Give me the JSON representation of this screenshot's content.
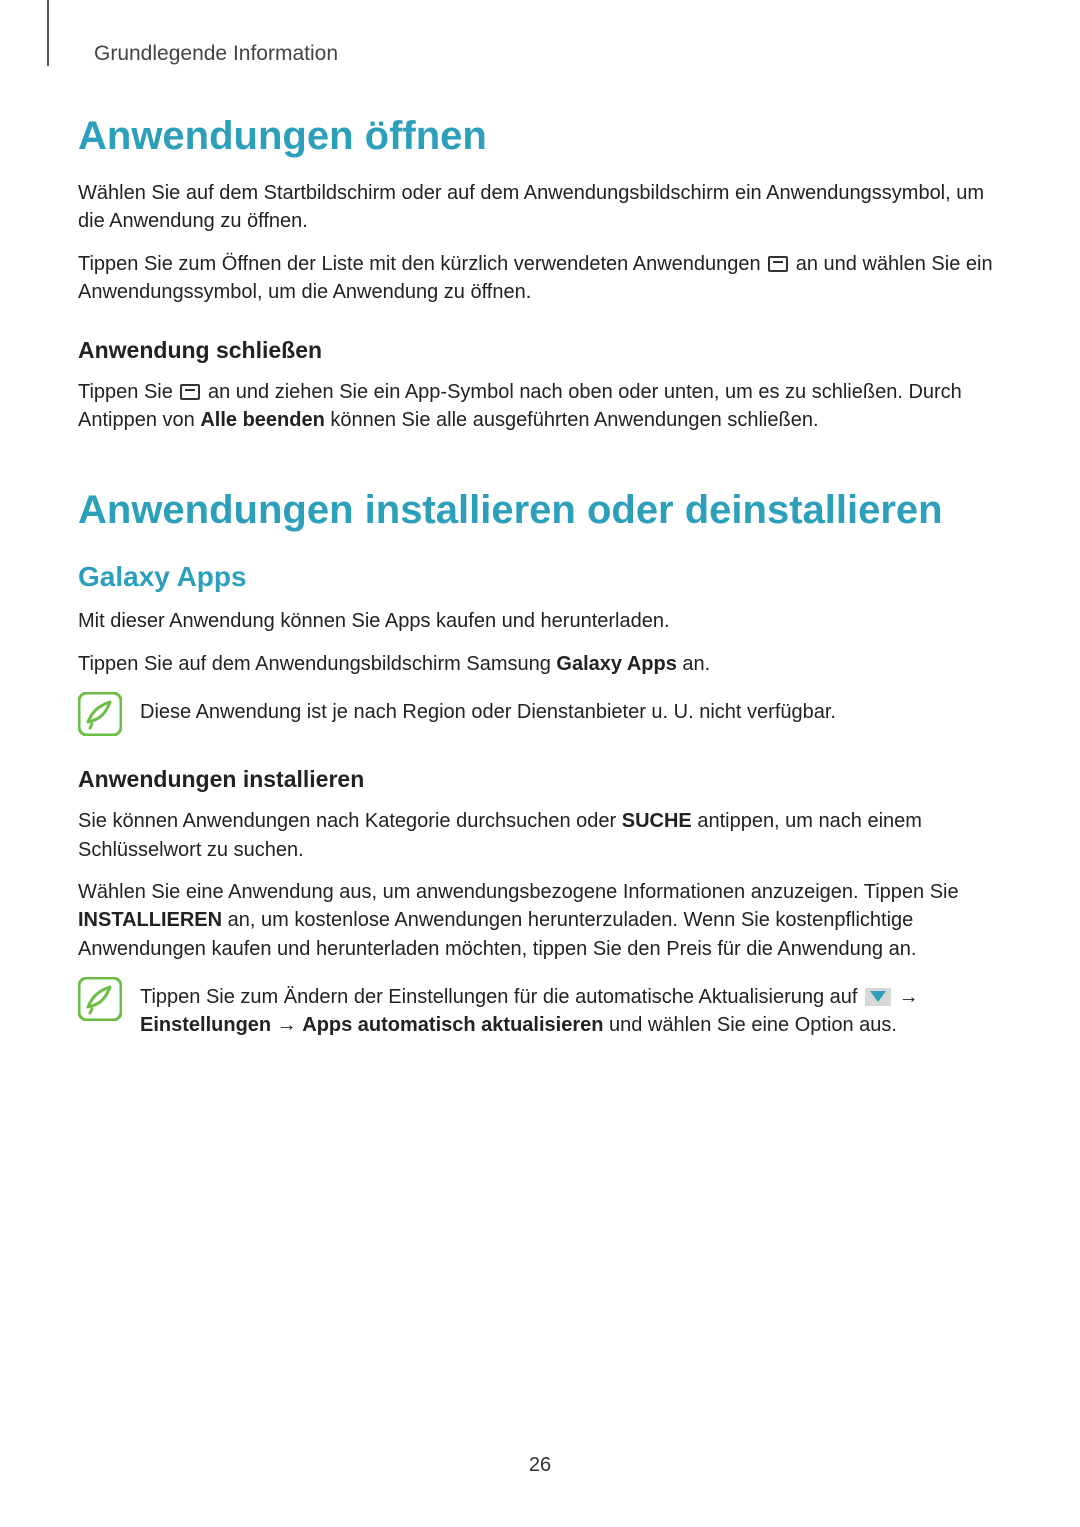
{
  "header": {
    "section_label": "Grundlegende Information"
  },
  "s1": {
    "title": "Anwendungen öffnen",
    "p1": "Wählen Sie auf dem Startbildschirm oder auf dem Anwendungsbildschirm ein Anwendungssymbol, um die Anwendung zu öffnen.",
    "p2a": "Tippen Sie zum Öffnen der Liste mit den kürzlich verwendeten Anwendungen ",
    "p2b": " an und wählen Sie ein Anwendungssymbol, um die Anwendung zu öffnen.",
    "sub1": "Anwendung schließen",
    "p3a": "Tippen Sie ",
    "p3b": " an und ziehen Sie ein App-Symbol nach oben oder unten, um es zu schließen. Durch Antippen von ",
    "p3_bold": "Alle beenden",
    "p3c": " können Sie alle ausgeführten Anwendungen schließen."
  },
  "s2": {
    "title": "Anwendungen installieren oder deinstallieren",
    "h2": "Galaxy Apps",
    "p1": "Mit dieser Anwendung können Sie Apps kaufen und herunterladen.",
    "p2a": "Tippen Sie auf dem Anwendungsbildschirm Samsung ",
    "p2_bold": "Galaxy Apps",
    "p2b": " an.",
    "note1": "Diese Anwendung ist je nach Region oder Dienstanbieter u. U. nicht verfügbar.",
    "sub1": "Anwendungen installieren",
    "p3a": "Sie können Anwendungen nach Kategorie durchsuchen oder ",
    "p3_bold": "SUCHE",
    "p3b": " antippen, um nach einem Schlüsselwort zu suchen.",
    "p4a": "Wählen Sie eine Anwendung aus, um anwendungsbezogene Informationen anzuzeigen. Tippen Sie ",
    "p4_bold": "INSTALLIEREN",
    "p4b": " an, um kostenlose Anwendungen herunterzuladen. Wenn Sie kostenpflichtige Anwendungen kaufen und herunterladen möchten, tippen Sie den Preis für die Anwendung an.",
    "note2a": "Tippen Sie zum Ändern der Einstellungen für die automatische Aktualisierung auf ",
    "note2_arrow": " → ",
    "note2_bold1": "Einstellungen",
    "note2_mid": " → ",
    "note2_bold2": "Apps automatisch aktualisieren",
    "note2b": " und wählen Sie eine Option aus."
  },
  "page_number": "26"
}
